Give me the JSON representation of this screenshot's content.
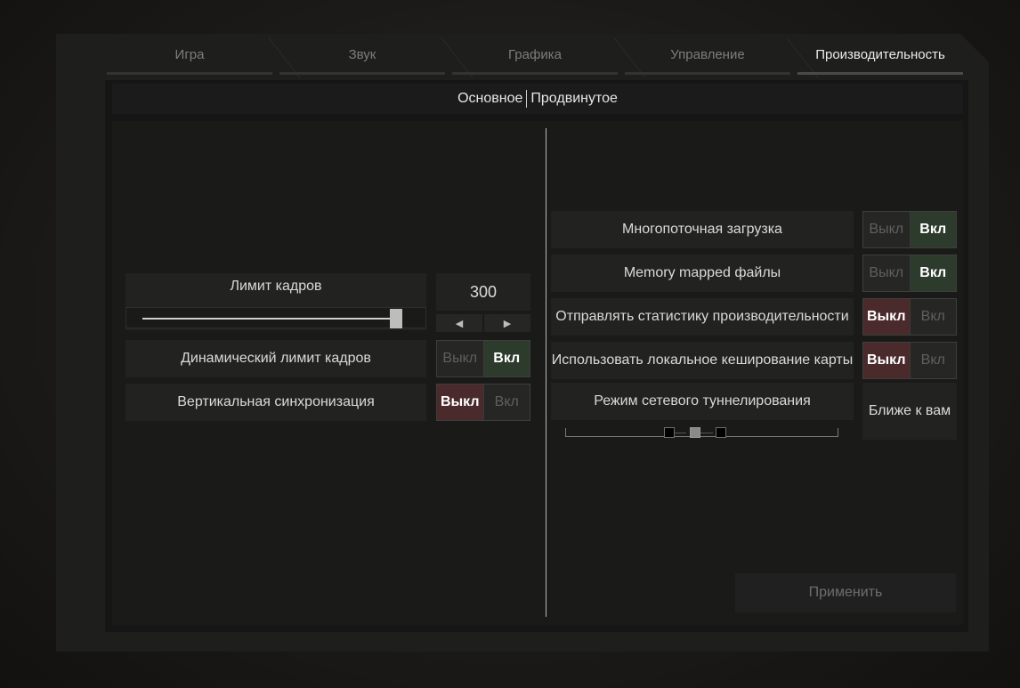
{
  "tabs": [
    {
      "label": "Игра"
    },
    {
      "label": "Звук"
    },
    {
      "label": "Графика"
    },
    {
      "label": "Управление"
    },
    {
      "label": "Производительность",
      "active": true
    }
  ],
  "subtabs": {
    "basic": "Основное",
    "advanced": "Продвинутое"
  },
  "left": {
    "frame_limit": {
      "label": "Лимит кадров",
      "value": "300",
      "slider_fraction": 1.0
    },
    "dynamic_frame_limit": {
      "label": "Динамический лимит кадров",
      "off": "Выкл",
      "on": "Вкл",
      "state": "on"
    },
    "vsync": {
      "label": "Вертикальная синхронизация",
      "off": "Выкл",
      "on": "Вкл",
      "state": "off"
    }
  },
  "right": {
    "multithread_loading": {
      "label": "Многопоточная загрузка",
      "off": "Выкл",
      "on": "Вкл",
      "state": "on"
    },
    "memory_mapped": {
      "label": "Memory mapped файлы",
      "off": "Выкл",
      "on": "Вкл",
      "state": "on"
    },
    "send_stats": {
      "label": "Отправлять статистику производительности",
      "off": "Выкл",
      "on": "Вкл",
      "state": "off"
    },
    "local_cache": {
      "label": "Использовать локальное кеширование карты",
      "off": "Выкл",
      "on": "Вкл",
      "state": "off"
    },
    "tunneling": {
      "label": "Режим сетевого туннелирования",
      "value": "Ближе к вам",
      "selected_index": 1,
      "steps": 3
    }
  },
  "apply_label": "Применить",
  "icons": {
    "left_arrow": "◀",
    "right_arrow": "▶"
  },
  "colors": {
    "on_green": "#2d3b2c",
    "off_red": "#4a2a2b"
  }
}
